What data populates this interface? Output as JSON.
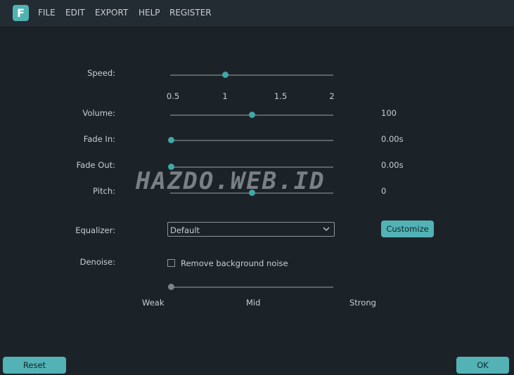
{
  "app": {
    "logo_letter": "F",
    "accent": "#4fb3b2"
  },
  "menu": [
    "FILE",
    "EDIT",
    "EXPORT",
    "HELP",
    "REGISTER"
  ],
  "speed": {
    "label": "Speed:",
    "value": 1,
    "ticks": [
      "0.5",
      "1",
      "1.5",
      "2"
    ]
  },
  "volume": {
    "label": "Volume:",
    "value": "100",
    "position": 0.5
  },
  "fade_in": {
    "label": "Fade In:",
    "value": "0.00s",
    "position": 0
  },
  "fade_out": {
    "label": "Fade Out:",
    "value": "0.00s",
    "position": 0
  },
  "pitch": {
    "label": "Pitch:",
    "value": "0",
    "position": 0.5
  },
  "watermark": "HAZDO.WEB.ID",
  "equalizer": {
    "label": "Equalizer:",
    "selected": "Default",
    "customize_label": "Customize"
  },
  "denoise": {
    "label": "Denoise:",
    "checkbox_label": "Remove background noise",
    "checked": false,
    "levels": [
      "Weak",
      "Mid",
      "Strong"
    ],
    "level": "Weak"
  },
  "footer": {
    "reset_label": "Reset",
    "ok_label": "OK"
  }
}
